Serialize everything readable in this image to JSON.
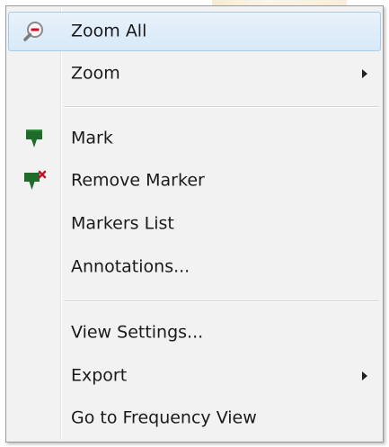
{
  "menu": {
    "items": [
      {
        "label": "Zoom All",
        "icon": "zoom-out-magnifier-icon",
        "highlighted": true
      },
      {
        "label": "Zoom",
        "submenu": true
      },
      {
        "label": "Mark",
        "icon": "marker-pin-icon"
      },
      {
        "label": "Remove Marker",
        "icon": "remove-marker-icon"
      },
      {
        "label": "Markers List"
      },
      {
        "label": "Annotations..."
      },
      {
        "label": "View Settings..."
      },
      {
        "label": "Export",
        "submenu": true
      },
      {
        "label": "Go to Frequency View"
      }
    ]
  },
  "colors": {
    "marker_green": "#1f6b2a",
    "remove_red": "#c8102e",
    "highlight_border": "#a8cbe8",
    "highlight_fill": "#dcebf9"
  }
}
